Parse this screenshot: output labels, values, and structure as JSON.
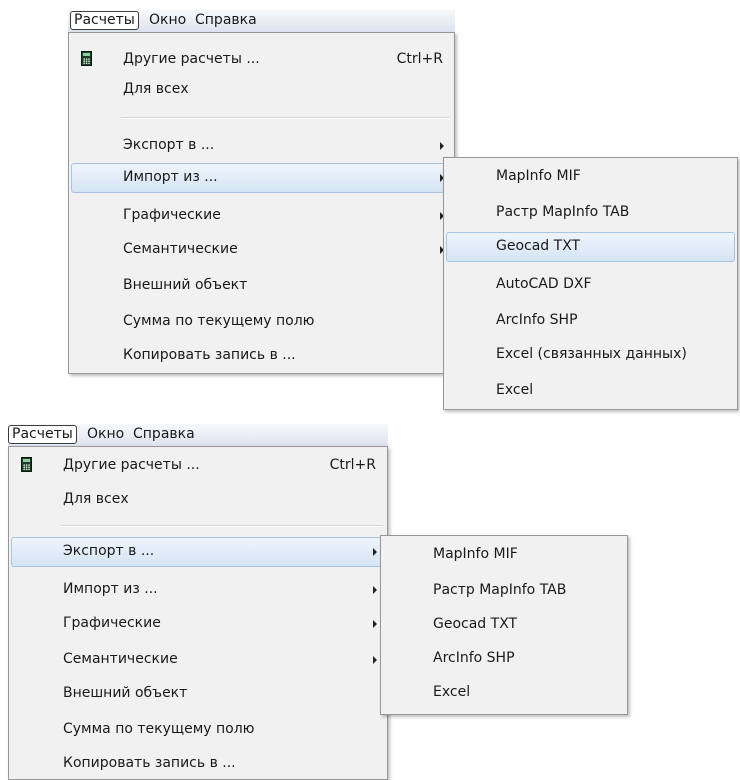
{
  "menubar": {
    "items": [
      {
        "label": "Расчеты",
        "active": true
      },
      {
        "label": "Окно",
        "active": false
      },
      {
        "label": "Справка",
        "active": false
      }
    ]
  },
  "menu": {
    "items": [
      {
        "label": "Другие расчеты ...",
        "shortcut": "Ctrl+R",
        "icon": "calculator-icon"
      },
      {
        "label": "Для всех"
      },
      {
        "label": "Экспорт в ...",
        "submenu": true
      },
      {
        "label": "Импорт из ...",
        "submenu": true
      },
      {
        "label": "Графические",
        "submenu": true
      },
      {
        "label": "Семантические",
        "submenu": true
      },
      {
        "label": "Внешний объект"
      },
      {
        "label": "Сумма по текущему полю"
      },
      {
        "label": "Копировать запись в ..."
      }
    ]
  },
  "import_submenu": {
    "items": [
      "MapInfo MIF",
      "Растр MapInfo TAB",
      "Geocad TXT",
      "AutoCAD DXF",
      "ArcInfo SHP",
      "Excel (связанных данных)",
      "Excel"
    ],
    "highlighted": "Geocad TXT"
  },
  "export_submenu": {
    "items": [
      "MapInfo MIF",
      "Растр MapInfo TAB",
      "Geocad TXT",
      "ArcInfo SHP",
      "Excel"
    ]
  },
  "colors": {
    "menu_bg": "#f1f1f1",
    "highlight_bg": "#d5e4f5",
    "highlight_border": "#a9c3e2",
    "menubar_bg": "#dde4ef"
  }
}
